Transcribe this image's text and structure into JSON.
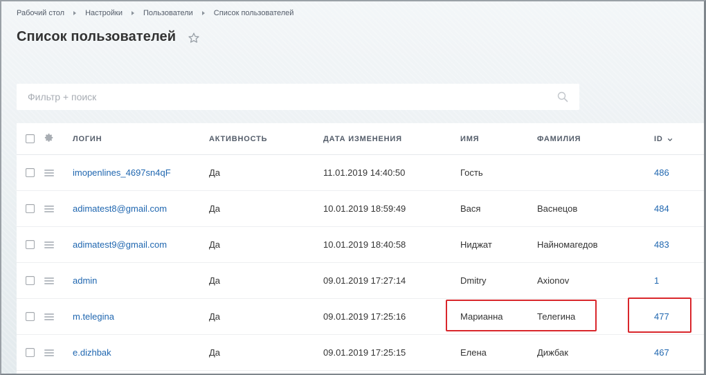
{
  "breadcrumb": [
    "Рабочий стол",
    "Настройки",
    "Пользователи",
    "Список пользователей"
  ],
  "page_title": "Список пользователей",
  "search": {
    "placeholder": "Фильтр + поиск"
  },
  "columns": {
    "login": "Логин",
    "active": "Активность",
    "date": "Дата изменения",
    "name": "Имя",
    "last": "Фамилия",
    "id": "ID"
  },
  "rows": [
    {
      "login": "imopenlines_4697sn4qF",
      "active": "Да",
      "date": "11.01.2019 14:40:50",
      "name": "Гость",
      "last": "",
      "id": "486"
    },
    {
      "login": "adimatest8@gmail.com",
      "active": "Да",
      "date": "10.01.2019 18:59:49",
      "name": "Вася",
      "last": "Васнецов",
      "id": "484"
    },
    {
      "login": "adimatest9@gmail.com",
      "active": "Да",
      "date": "10.01.2019 18:40:58",
      "name": "Ниджат",
      "last": "Найномагедов",
      "id": "483"
    },
    {
      "login": "admin",
      "active": "Да",
      "date": "09.01.2019 17:27:14",
      "name": "Dmitry",
      "last": "Axionov",
      "id": "1"
    },
    {
      "login": "m.telegina",
      "active": "Да",
      "date": "09.01.2019 17:25:16",
      "name": "Марианна",
      "last": "Телегина",
      "id": "477"
    },
    {
      "login": "e.dizhbak",
      "active": "Да",
      "date": "09.01.2019 17:25:15",
      "name": "Елена",
      "last": "Дижбак",
      "id": "467"
    }
  ],
  "colors": {
    "link": "#2067b0",
    "highlight": "#d9262b"
  }
}
